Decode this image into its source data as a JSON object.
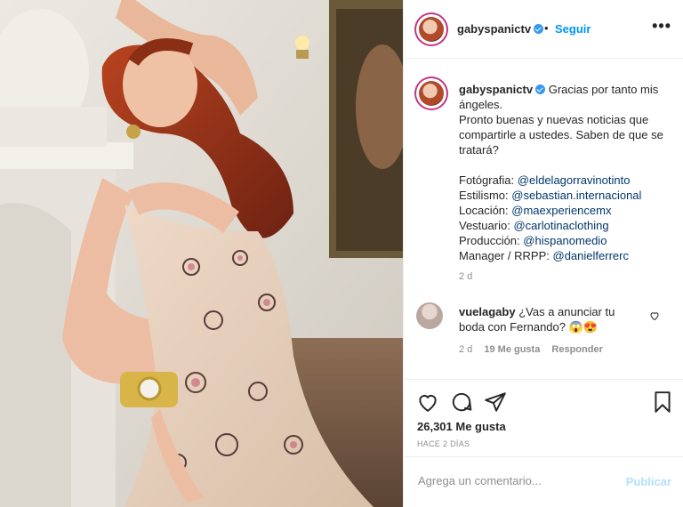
{
  "post": {
    "image_alt": "",
    "author": "gabyspanictv",
    "verified": true,
    "separator": "•",
    "follow_label": "Seguir",
    "more_label": "•••"
  },
  "caption": {
    "author": "gabyspanictv",
    "line1": "Gracias por tanto mis ángeles.",
    "line2": "Pronto buenas y nuevas noticias que compartirle a ustedes. Saben de que se tratará?",
    "credits": [
      {
        "label": "Fotógrafia:",
        "handle": "@eldelagorravinotinto"
      },
      {
        "label": "Estilismo:",
        "handle": "@sebastian.internacional"
      },
      {
        "label": "Locación:",
        "handle": "@maexperiencemx"
      },
      {
        "label": "Vestuario:",
        "handle": "@carlotinaclothing"
      },
      {
        "label": "Producción:",
        "handle": "@hispanomedio"
      },
      {
        "label": "Manager / RRPP:",
        "handle": "@danielferrerc"
      }
    ],
    "time": "2 d"
  },
  "comment": {
    "user": "vuelagaby",
    "text": "¿Vas a anunciar tu boda con Fernando? 😱😍",
    "time": "2 d",
    "likes": "19 Me gusta",
    "reply_label": "Responder"
  },
  "actions": {
    "likes_count": "26,301 Me gusta",
    "posted_ago": "HACE 2 DÍAS"
  },
  "composer": {
    "placeholder": "Agrega un comentario...",
    "publish_label": "Publicar"
  },
  "colors": {
    "accent": "#0095f6",
    "verified": "#3897f0",
    "publish_disabled": "#b2dffc",
    "link": "#00376b"
  }
}
